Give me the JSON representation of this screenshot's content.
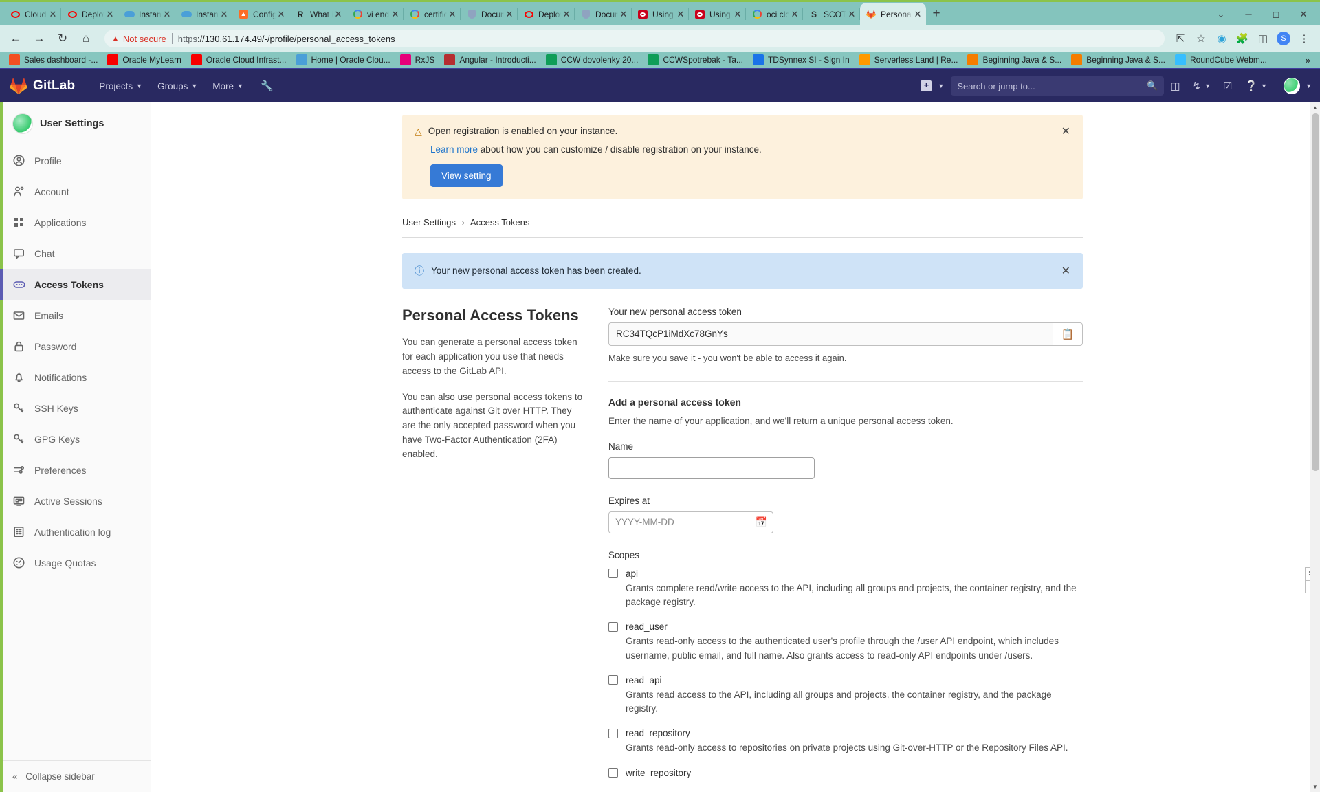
{
  "browser": {
    "tabs": [
      {
        "title": "Cloud S",
        "favicon": "oracle-icon",
        "color": "#f80000",
        "shape": "ring"
      },
      {
        "title": "Deploy",
        "favicon": "oracle-icon",
        "color": "#f80000",
        "shape": "ring"
      },
      {
        "title": "Instanc",
        "favicon": "cloud-icon",
        "color": "#4a9fd8",
        "shape": "cloud"
      },
      {
        "title": "Instanc",
        "favicon": "cloud-icon",
        "color": "#4a9fd8",
        "shape": "cloud"
      },
      {
        "title": "Configu",
        "favicon": "gitlab-icon",
        "color": "#fc6d26",
        "shape": "box"
      },
      {
        "title": "What is",
        "favicon": "r-icon",
        "color": "#222222",
        "shape": "letter",
        "letter": "R"
      },
      {
        "title": "vi end o",
        "favicon": "google-icon",
        "color": "#4285f4",
        "shape": "g",
        "letter": "G"
      },
      {
        "title": "certifica",
        "favicon": "google-icon",
        "color": "#4285f4",
        "shape": "g",
        "letter": "G"
      },
      {
        "title": "Docum",
        "favicon": "shield-icon",
        "color": "#8fa3c0",
        "shape": "shield"
      },
      {
        "title": "Deploy",
        "favicon": "oracle-icon",
        "color": "#f80000",
        "shape": "ring"
      },
      {
        "title": "Docum",
        "favicon": "shield-icon",
        "color": "#8fa3c0",
        "shape": "shield"
      },
      {
        "title": "Using O",
        "favicon": "oracle-icon",
        "color": "#c8001b",
        "shape": "filled-ring"
      },
      {
        "title": "Using O",
        "favicon": "oracle-icon",
        "color": "#c8001b",
        "shape": "filled-ring"
      },
      {
        "title": "oci clou",
        "favicon": "google-icon",
        "color": "#4285f4",
        "shape": "g",
        "letter": "G"
      },
      {
        "title": "SCOTT",
        "favicon": "s-icon",
        "color": "#333333",
        "shape": "letter",
        "letter": "S"
      },
      {
        "title": "Persona",
        "favicon": "gitlab-icon",
        "color": "#fc6d26",
        "shape": "fox",
        "active": true
      }
    ],
    "new_tab_label": "+",
    "window_controls": [
      "⌄",
      "─",
      "☐",
      "✕"
    ],
    "nav": {
      "back": "←",
      "forward": "→",
      "reload": "↻",
      "home": "⌂"
    },
    "omnibox": {
      "security_warning": "Not secure",
      "url_scheme": "https",
      "url_rest": "://130.61.174.49/-/profile/personal_access_tokens"
    },
    "toolbar_icons": [
      "share-icon",
      "bookmark-star-icon",
      "extension-puzzle-icon",
      "extension-icon",
      "sidepanel-icon",
      "profile-avatar",
      "more-menu-icon"
    ],
    "bookmarks": [
      {
        "label": "Sales dashboard -...",
        "icon": "microsoft-icon",
        "color": "#f25022"
      },
      {
        "label": "Oracle MyLearn",
        "icon": "oracle-icon",
        "color": "#f80000"
      },
      {
        "label": "Oracle Cloud Infrast...",
        "icon": "oracle-icon",
        "color": "#f80000"
      },
      {
        "label": "Home | Oracle Clou...",
        "icon": "cloud-icon",
        "color": "#4a9fd8"
      },
      {
        "label": "RxJS",
        "icon": "rxjs-icon",
        "color": "#e6007a"
      },
      {
        "label": "Angular - Introducti...",
        "icon": "angular-icon",
        "color": "#b52e31"
      },
      {
        "label": "CCW dovolenky 20...",
        "icon": "sheets-icon",
        "color": "#0f9d58"
      },
      {
        "label": "CCWSpotrebak - Ta...",
        "icon": "sheets-icon",
        "color": "#0f9d58"
      },
      {
        "label": "TDSynnex SI - Sign In",
        "icon": "q-icon",
        "color": "#1a73e8"
      },
      {
        "label": "Serverless Land | Re...",
        "icon": "aws-icon",
        "color": "#ff9900"
      },
      {
        "label": "Beginning Java & S...",
        "icon": "blogger-icon",
        "color": "#f57d00"
      },
      {
        "label": "Beginning Java & S...",
        "icon": "blogger-icon",
        "color": "#f57d00"
      },
      {
        "label": "RoundCube Webm...",
        "icon": "roundcube-icon",
        "color": "#37beff"
      }
    ],
    "bookmarks_overflow": "»"
  },
  "gitlab": {
    "brand": "GitLab",
    "nav": [
      {
        "label": "Projects"
      },
      {
        "label": "Groups"
      },
      {
        "label": "More"
      }
    ],
    "wrench_icon": "wrench-icon",
    "create_new_label": "",
    "search_placeholder": "Search or jump to...",
    "header_icons": [
      "issues-icon",
      "merge-requests-icon",
      "todos-icon",
      "help-icon"
    ]
  },
  "sidebar": {
    "title": "User Settings",
    "items": [
      {
        "label": "Profile",
        "icon": "user-icon",
        "active": false
      },
      {
        "label": "Account",
        "icon": "account-gear-icon",
        "active": false
      },
      {
        "label": "Applications",
        "icon": "applications-grid-icon",
        "active": false
      },
      {
        "label": "Chat",
        "icon": "chat-bubble-icon",
        "active": false
      },
      {
        "label": "Access Tokens",
        "icon": "token-icon",
        "active": true
      },
      {
        "label": "Emails",
        "icon": "envelope-icon",
        "active": false
      },
      {
        "label": "Password",
        "icon": "lock-icon",
        "active": false
      },
      {
        "label": "Notifications",
        "icon": "bell-icon",
        "active": false
      },
      {
        "label": "SSH Keys",
        "icon": "key-icon",
        "active": false
      },
      {
        "label": "GPG Keys",
        "icon": "key-icon",
        "active": false
      },
      {
        "label": "Preferences",
        "icon": "sliders-icon",
        "active": false
      },
      {
        "label": "Active Sessions",
        "icon": "monitor-icon",
        "active": false
      },
      {
        "label": "Authentication log",
        "icon": "log-list-icon",
        "active": false
      },
      {
        "label": "Usage Quotas",
        "icon": "gauge-icon",
        "active": false
      }
    ],
    "collapse_label": "Collapse sidebar"
  },
  "alerts": {
    "warning": {
      "title": "Open registration is enabled on your instance.",
      "link_text": "Learn more",
      "body_rest": " about how you can customize / disable registration on your instance.",
      "button": "View setting",
      "close": "✕"
    },
    "info": {
      "text": "Your new personal access token has been created.",
      "close": "✕"
    }
  },
  "breadcrumb": {
    "root": "User Settings",
    "separator": "›",
    "current": "Access Tokens"
  },
  "page": {
    "title": "Personal Access Tokens",
    "desc_p1": "You can generate a personal access token for each application you use that needs access to the GitLab API.",
    "desc_p2": "You can also use personal access tokens to authenticate against Git over HTTP. They are the only accepted password when you have Two-Factor Authentication (2FA) enabled."
  },
  "new_token": {
    "label": "Your new personal access token",
    "value": "RC34TQcP1iMdXc78GnYs",
    "copy_icon": "copy-icon",
    "hint": "Make sure you save it - you won't be able to access it again."
  },
  "add_token": {
    "heading": "Add a personal access token",
    "description": "Enter the name of your application, and we'll return a unique personal access token.",
    "name_label": "Name",
    "name_value": "",
    "expires_label": "Expires at",
    "expires_placeholder": "YYYY-MM-DD",
    "calendar_icon": "calendar-icon",
    "scopes_label": "Scopes",
    "scopes": [
      {
        "name": "api",
        "checked": false,
        "description": "Grants complete read/write access to the API, including all groups and projects, the container registry, and the package registry."
      },
      {
        "name": "read_user",
        "checked": false,
        "description": "Grants read-only access to the authenticated user's profile through the /user API endpoint, which includes username, public email, and full name. Also grants access to read-only API endpoints under /users."
      },
      {
        "name": "read_api",
        "checked": false,
        "description": "Grants read access to the API, including all groups and projects, the container registry, and the package registry."
      },
      {
        "name": "read_repository",
        "checked": false,
        "description": "Grants read-only access to repositories on private projects using Git-over-HTTP or the Repository Files API."
      },
      {
        "name": "write_repository",
        "checked": false,
        "description": ""
      }
    ]
  },
  "colors": {
    "gitlab_header": "#292961",
    "accent_green": "#8bc34a",
    "primary_button": "#367ad6",
    "warning_bg": "#fdf1dd",
    "info_bg": "#cfe3f7",
    "link": "#1f75cb"
  }
}
